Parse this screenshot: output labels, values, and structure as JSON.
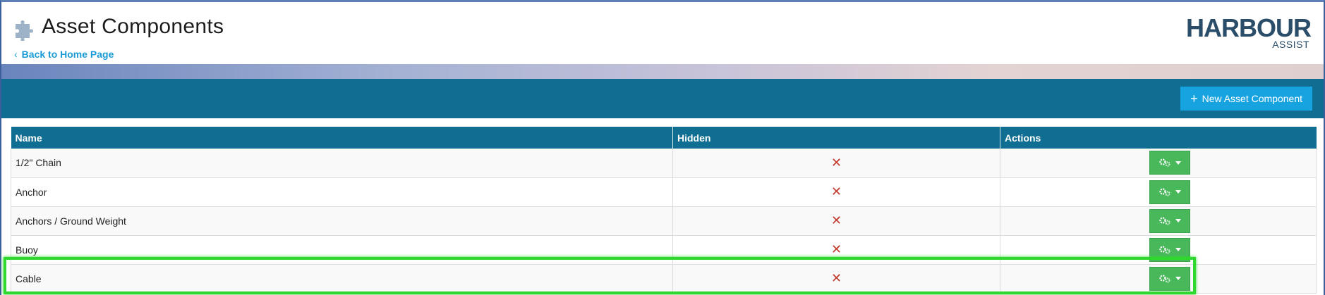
{
  "page": {
    "title": "Asset Components",
    "back_link": "Back to Home Page",
    "logo_word": "HARBOUR",
    "logo_sub": "ASSIST"
  },
  "toolbar": {
    "new_button": "New Asset Component"
  },
  "table": {
    "headers": [
      "Name",
      "Hidden",
      "Actions"
    ],
    "rows": [
      {
        "name": "1/2\" Chain",
        "hidden": "✕"
      },
      {
        "name": "Anchor",
        "hidden": "✕"
      },
      {
        "name": "Anchors / Ground Weight",
        "hidden": "✕"
      },
      {
        "name": "Buoy",
        "hidden": "✕"
      },
      {
        "name": "Cable",
        "hidden": "✕"
      }
    ]
  },
  "colors": {
    "accent": "#0f6e91",
    "button_blue": "#17a3e0",
    "action_green": "#48b85b",
    "hidden_x": "#c0392b",
    "highlight": "#2fd82f"
  },
  "icons": {
    "header_icon": "puzzle-piece-icon",
    "back_icon": "chevron-left-icon",
    "add_icon": "plus-icon",
    "row_action_icon": "gears-icon",
    "dropdown_icon": "caret-down-icon"
  }
}
